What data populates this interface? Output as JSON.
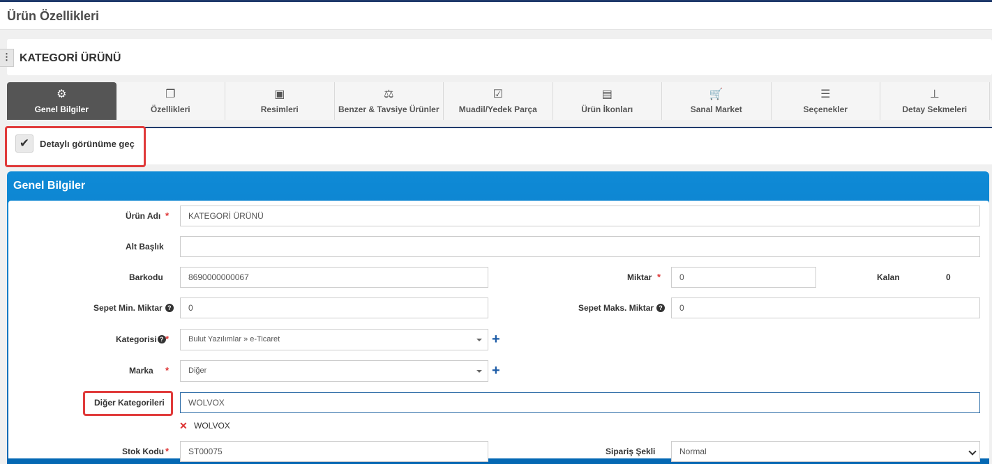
{
  "page": {
    "title": "Ürün Özellikleri"
  },
  "product": {
    "name": "KATEGORİ ÜRÜNÜ",
    "menu_icon": "vertical-dots-icon"
  },
  "tabs": [
    {
      "label": "Genel Bilgiler",
      "icon": "gears-icon",
      "active": true
    },
    {
      "label": "Özellikleri",
      "icon": "copy-icon"
    },
    {
      "label": "Resimleri",
      "icon": "images-icon"
    },
    {
      "label": "Benzer & Tavsiye Ürünler",
      "icon": "balance-scale-icon"
    },
    {
      "label": "Muadil/Yedek Parça",
      "icon": "check-square-icon"
    },
    {
      "label": "Ürün İkonları",
      "icon": "file-image-icon"
    },
    {
      "label": "Sanal Market",
      "icon": "cart-icon"
    },
    {
      "label": "Seçenekler",
      "icon": "list-icon"
    },
    {
      "label": "Detay Sekmeleri",
      "icon": "sitemap-icon"
    }
  ],
  "toggle": {
    "label": "Detaylı görünüme geç",
    "checked": true
  },
  "panel": {
    "title": "Genel Bilgiler"
  },
  "form": {
    "urun_adi": {
      "label": "Ürün Adı",
      "value": "KATEGORİ ÜRÜNÜ"
    },
    "alt_baslik": {
      "label": "Alt Başlık",
      "value": ""
    },
    "barkodu": {
      "label": "Barkodu",
      "value": "8690000000067"
    },
    "miktar": {
      "label": "Miktar",
      "value": "0"
    },
    "kalan": {
      "label": "Kalan",
      "value": "0"
    },
    "sepet_min": {
      "label": "Sepet Min. Miktar",
      "value": "0"
    },
    "sepet_maks": {
      "label": "Sepet Maks. Miktar",
      "value": "0"
    },
    "kategorisi": {
      "label": "Kategorisi",
      "value": "Bulut Yazılımlar » e-Ticaret"
    },
    "marka": {
      "label": "Marka",
      "value": "Diğer"
    },
    "diger_kategoriler": {
      "label": "Diğer Kategorileri",
      "value": "WOLVOX",
      "tags": [
        "WOLVOX"
      ]
    },
    "stok_kodu": {
      "label": "Stok Kodu",
      "value": "ST00075"
    },
    "siparis_sekli": {
      "label": "Sipariş Şekli",
      "value": "Normal"
    }
  },
  "colors": {
    "accent": "#0a7ac9",
    "highlight": "#e03a3a",
    "required": "#d33333"
  }
}
